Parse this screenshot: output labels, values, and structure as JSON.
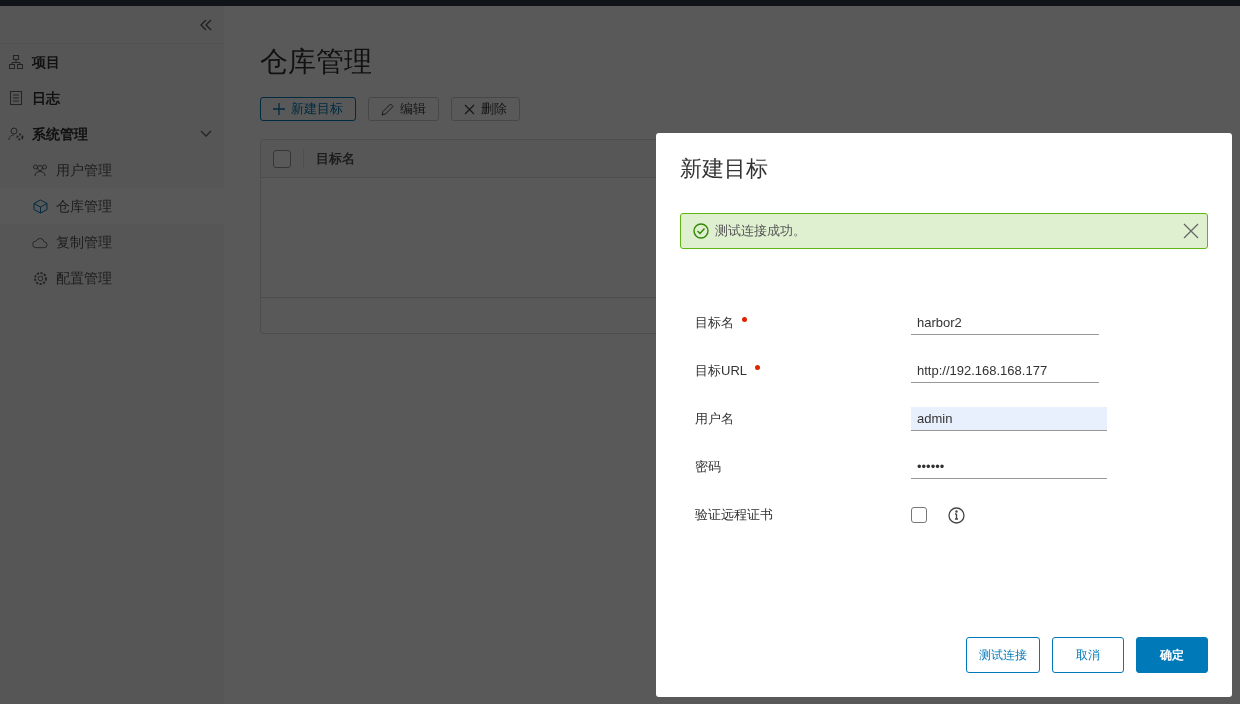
{
  "sidebar": {
    "items": [
      {
        "label": "项目"
      },
      {
        "label": "日志"
      },
      {
        "label": "系统管理",
        "expanded": true,
        "children": [
          {
            "label": "用户管理",
            "selected": false
          },
          {
            "label": "仓库管理",
            "selected": true
          },
          {
            "label": "复制管理",
            "selected": false
          },
          {
            "label": "配置管理",
            "selected": false
          }
        ]
      }
    ]
  },
  "page": {
    "title": "仓库管理",
    "toolbar": [
      {
        "label": "新建目标",
        "disabled": false
      },
      {
        "label": "编辑",
        "disabled": true
      },
      {
        "label": "删除",
        "disabled": true
      }
    ],
    "table": {
      "columns": [
        "目标名"
      ],
      "select_all": {
        "checked": false
      }
    }
  },
  "dialog": {
    "title": "新建目标",
    "alert": {
      "kind": "success",
      "text": "测试连接成功。"
    },
    "fields": [
      {
        "kind": "text",
        "label": "目标名",
        "required": true,
        "value": "harbor2",
        "autofilled": false
      },
      {
        "kind": "text",
        "label": "目标URL",
        "required": true,
        "value": "http://192.168.168.177",
        "autofilled": false
      },
      {
        "kind": "text",
        "label": "用户名",
        "required": false,
        "value": "admin",
        "autofilled": true
      },
      {
        "kind": "text",
        "label": "密码",
        "required": false,
        "value": "••••••",
        "autofilled": false
      },
      {
        "kind": "checkbox",
        "label": "验证远程证书",
        "required": false,
        "checked": false
      }
    ],
    "buttons": [
      {
        "label": "测试连接",
        "kind": "outline"
      },
      {
        "label": "取消",
        "kind": "outline"
      },
      {
        "label": "确定",
        "kind": "primary"
      }
    ]
  }
}
